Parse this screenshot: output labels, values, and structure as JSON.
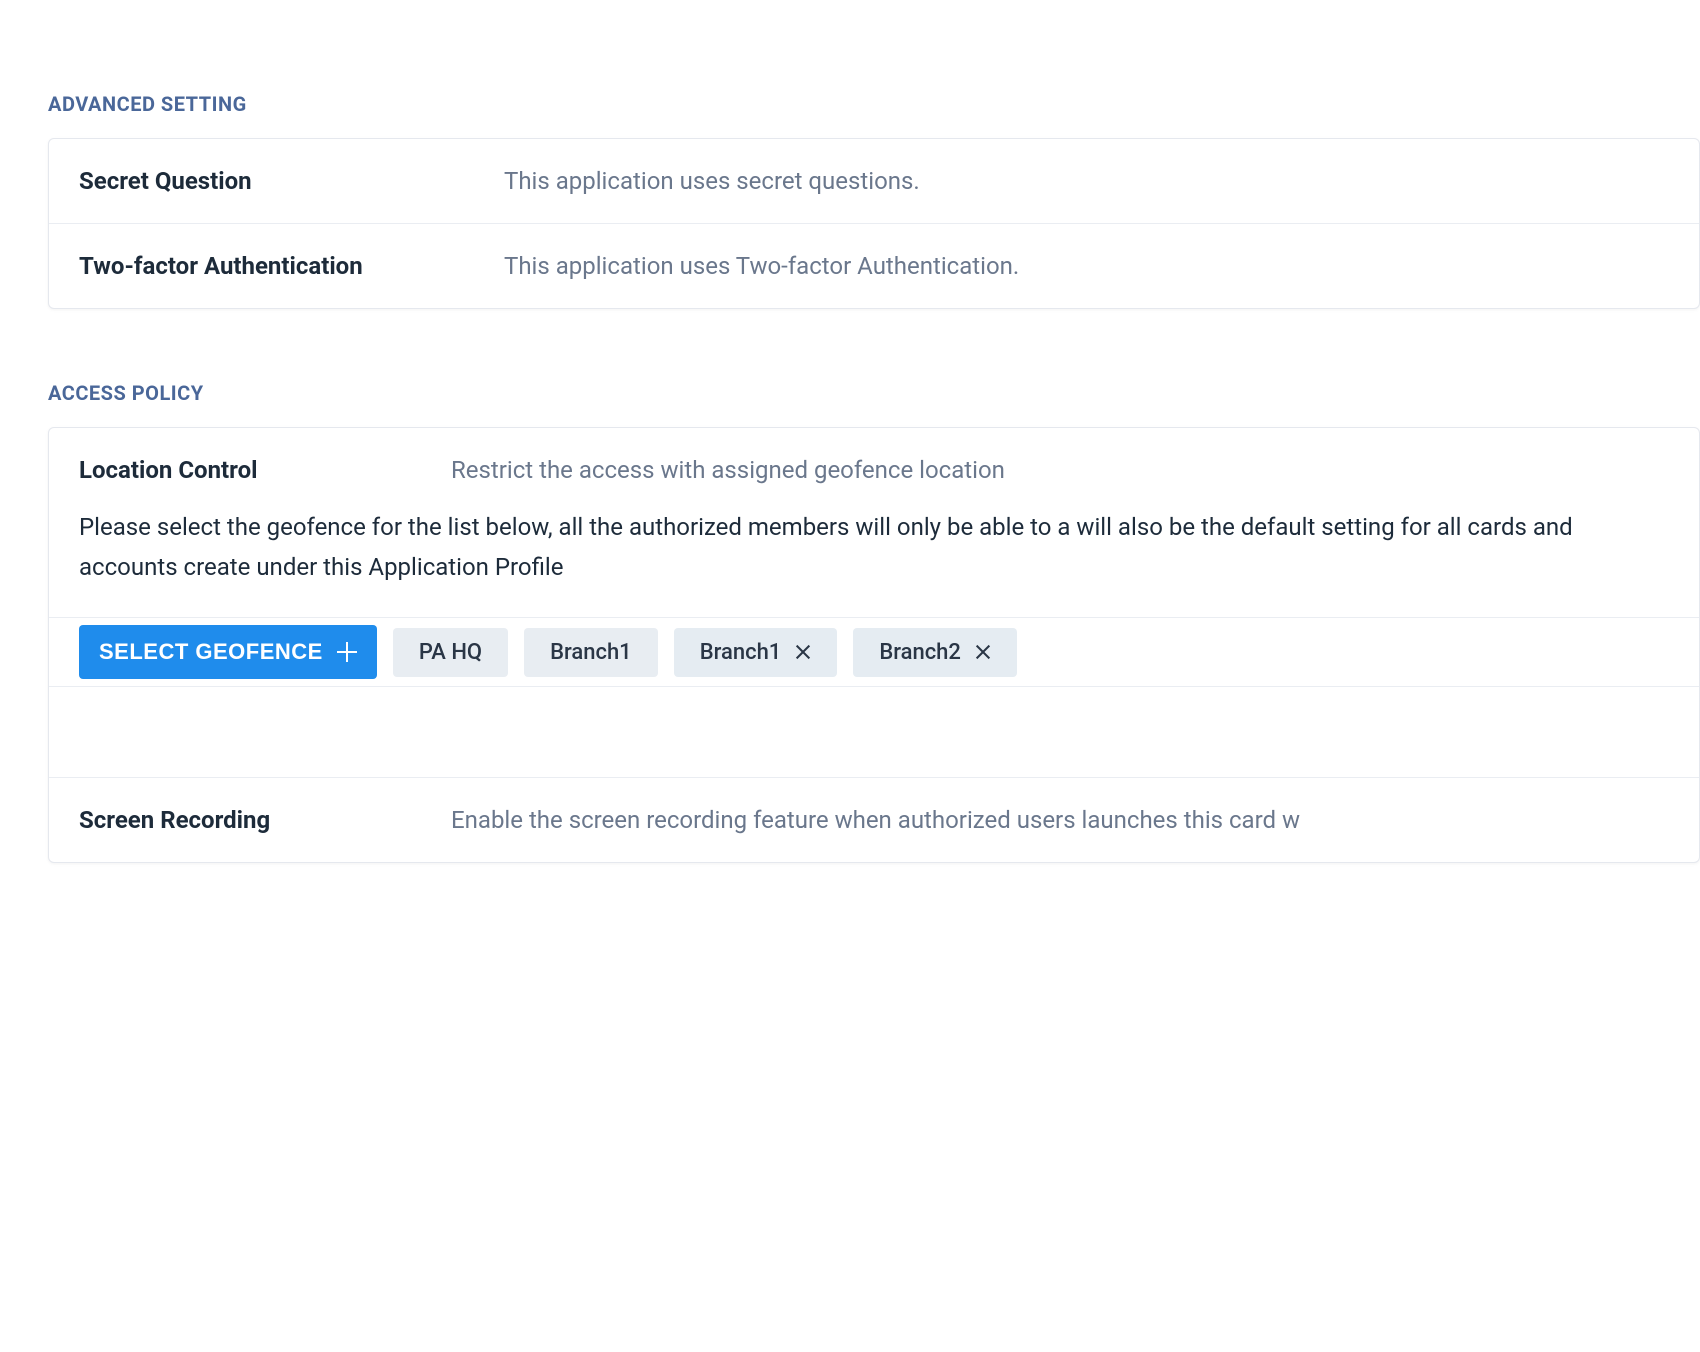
{
  "advanced": {
    "header": "ADVANCED SETTING",
    "rows": [
      {
        "label": "Secret Question",
        "desc": "This application uses secret questions."
      },
      {
        "label": "Two-factor Authentication",
        "desc": "This application uses Two-factor Authentication."
      }
    ]
  },
  "policy": {
    "header": "ACCESS POLICY",
    "location": {
      "label": "Location Control",
      "desc": "Restrict the access with assigned geofence location",
      "body": "Please select the geofence for the list below, all the authorized members will only be able to a will also be the default setting for all cards and accounts create under this Application Profile"
    },
    "geofence_button": "SELECT GEOFENCE",
    "chips": [
      {
        "label": "PA HQ",
        "removable": false
      },
      {
        "label": "Branch1",
        "removable": false
      },
      {
        "label": "Branch1",
        "removable": true
      },
      {
        "label": "Branch2",
        "removable": true
      }
    ],
    "screen_recording": {
      "label": "Screen Recording",
      "desc": "Enable the screen recording feature when authorized users launches this card w"
    }
  }
}
